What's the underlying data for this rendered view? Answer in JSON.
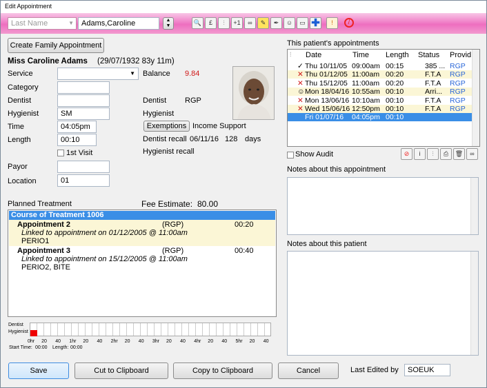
{
  "window": {
    "title": "Edit Appointment"
  },
  "toolbar": {
    "search_placeholder": "Last Name",
    "patient_name": "Adams,Caroline",
    "plus_one": "+1"
  },
  "left": {
    "family_button": "Create Family Appointment",
    "patient_header": "Miss Caroline Adams",
    "patient_dob": "(29/07/1932 83y 11m)",
    "labels": {
      "service": "Service",
      "category": "Category",
      "dentist": "Dentist",
      "hygienist": "Hygienist",
      "time": "Time",
      "length": "Length",
      "payor": "Payor",
      "location": "Location",
      "balance": "Balance",
      "dentist2": "Dentist",
      "hygienist2": "Hygienist"
    },
    "values": {
      "hygienist": "SM",
      "time": "04:05pm",
      "length": "00:10",
      "location": "01",
      "balance": "9.84",
      "dentist2": "RGP"
    },
    "first_visit": "1st Visit",
    "exemptions_button": "Exemptions",
    "income_support": "Income Support",
    "dentist_recall_label": "Dentist recall",
    "dentist_recall_date": "06/11/16",
    "dentist_recall_days": "128",
    "days_unit": "days",
    "hygienist_recall": "Hygienist recall"
  },
  "planned": {
    "label": "Planned Treatment",
    "fee_label": "Fee Estimate:",
    "fee_value": "80.00",
    "course": "Course of Treatment 1006",
    "appointments": [
      {
        "name": "Appointment 2",
        "who": "(RGP)",
        "dur": "00:20",
        "link": "Linked to appointment on 01/12/2005 @ 11:00am",
        "items": "PERIO1"
      },
      {
        "name": "Appointment 3",
        "who": "(RGP)",
        "dur": "00:40",
        "link": "Linked to appointment on 15/12/2005 @ 11:00am",
        "items": "PERIO2, BITE"
      }
    ]
  },
  "timeline": {
    "rows": [
      "Dentist",
      "Hygienist"
    ],
    "ticks": [
      "0hr",
      "20",
      "40",
      "1hr",
      "20",
      "40",
      "2hr",
      "20",
      "40",
      "3hr",
      "20",
      "40",
      "4hr",
      "20",
      "40",
      "5hr",
      "20",
      "40"
    ],
    "start_label": "Start Time:",
    "start_value": "00:00",
    "length_label": "Length:",
    "length_value": "00:00"
  },
  "appointments": {
    "title": "This patient's appointments",
    "headers": [
      "Date",
      "Time",
      "Length",
      "Status",
      "Provid"
    ],
    "rows": [
      {
        "date": "Thu 10/11/05",
        "time": "09:00am",
        "length": "00:15",
        "status": "385 ...",
        "prov": "RGP",
        "mark": "✓"
      },
      {
        "date": "Thu 01/12/05",
        "time": "11:00am",
        "length": "00:20",
        "status": "F.T.A",
        "prov": "RGP",
        "mark": "✕"
      },
      {
        "date": "Thu 15/12/05",
        "time": "11:00am",
        "length": "00:20",
        "status": "F.T.A",
        "prov": "RGP",
        "mark": "✕"
      },
      {
        "date": "Mon 18/04/16",
        "time": "10:55am",
        "length": "00:10",
        "status": "Arri...",
        "prov": "RGP",
        "mark": "☺"
      },
      {
        "date": "Mon 13/06/16",
        "time": "10:10am",
        "length": "00:10",
        "status": "F.T.A",
        "prov": "RGP",
        "mark": "✕"
      },
      {
        "date": "Wed 15/06/16",
        "time": "12:50pm",
        "length": "00:10",
        "status": "F.T.A",
        "prov": "RGP",
        "mark": "✕"
      },
      {
        "date": "Fri 01/07/16",
        "time": "04:05pm",
        "length": "00:10",
        "status": "",
        "prov": "",
        "mark": ""
      }
    ],
    "show_audit": "Show Audit"
  },
  "notes": {
    "appointment_label": "Notes about this appointment",
    "patient_label": "Notes about this patient"
  },
  "footer": {
    "save": "Save",
    "cut": "Cut to Clipboard",
    "copy": "Copy to Clipboard",
    "cancel": "Cancel",
    "last_edited_label": "Last Edited by",
    "last_edited_value": "SOEUK"
  }
}
